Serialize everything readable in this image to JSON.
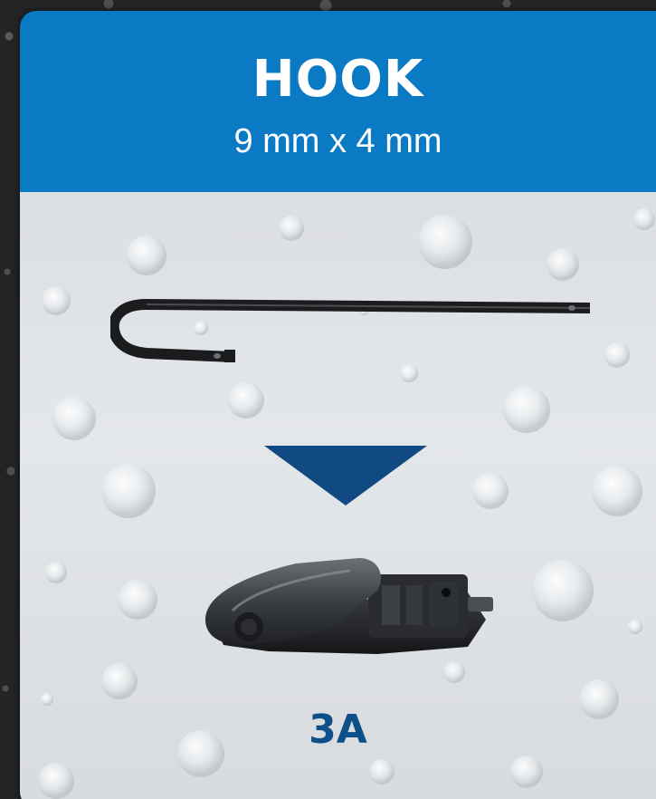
{
  "header": {
    "title": "HOOK",
    "subtitle": "9 mm x 4 mm"
  },
  "result": {
    "code": "3A"
  },
  "icons": {
    "connector_image": "hook-pin-icon",
    "direction": "down-arrow-icon",
    "adapter_image": "wiper-adapter-icon"
  },
  "colors": {
    "header_bg": "#0a7ac4",
    "arrow": "#114a82",
    "code_text": "#0e4f8a"
  }
}
